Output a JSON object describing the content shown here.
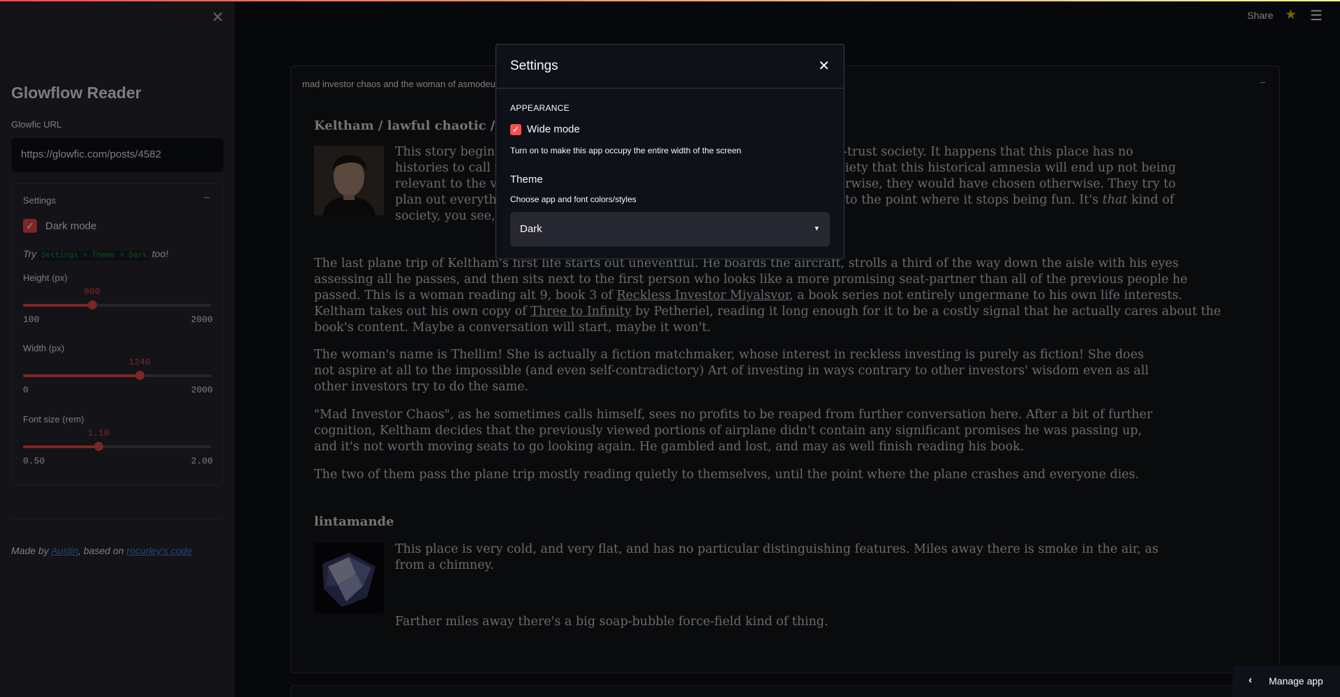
{
  "sidebar": {
    "close_glyph": "✕",
    "title": "Glowflow Reader",
    "url_label": "Glowfic URL",
    "url_value": "https://glowfic.com/posts/4582",
    "settings_title": "Settings",
    "collapse_glyph": "−",
    "dark_mode_label": "Dark mode",
    "dark_mode_checked": true,
    "try_prefix": "Try",
    "try_code": "Settings > Theme > Dark",
    "try_suffix": "too!",
    "height": {
      "label": "Height (px)",
      "value": "800",
      "min": "100",
      "max": "2000",
      "fraction": 0.3684
    },
    "width": {
      "label": "Width (px)",
      "value": "1240",
      "min": "0",
      "max": "2000",
      "fraction": 0.62
    },
    "font_size": {
      "label": "Font size (rem)",
      "value": "1.10",
      "min": "0.50",
      "max": "2.00",
      "fraction": 0.4
    },
    "credits_prefix": "Made by",
    "credits_author": "Austin",
    "credits_mid": ", based on",
    "credits_link": "rocurley's code"
  },
  "header": {
    "share_label": "Share",
    "star_icon": "★",
    "menu_icon": "☰"
  },
  "card": {
    "title": "mad investor chaos and the woman of asmodeus",
    "minimize_glyph": "–"
  },
  "posts": [
    {
      "author": "Keltham / lawful chaotic / Iarwain",
      "paragraphs": [
        "This story begins in a world called Dath Ilan, a world with a civilization that is a high-trust society.  It happens that this place has no histories to call up; it is a place where nothing bad happens and everything that this historical amnesia will end up not being relevant to the various arcs of this story, so that if the characters knew otherwise, they would have chosen otherwise.  They try to plan out everything through their extensive coordination, and they generally succeed to the point where it stops being fun.  It's that kind of society, you see, they are."
      ]
    },
    {
      "paragraphs": [
        "The last plane trip of Keltham's first life starts out uneventful.  He boards the aircraft, strolls a third of the way down the aisle with his eyes assessing all he passes, and then sits next to the first person who looks like a more promising seat-partner than all of the previous people he passed.  This is a woman reading alt 9, book 3 of Reckless Investor Miyalsvor, a book series not entirely ungermane to his own life interests.  Keltham takes out his own copy of Three to Infinity by Petheriel, reading it long enough for it to be a costly signal that he actually cares about the book's content.  Maybe a conversation will start, maybe it won't.",
        "The woman's name is Thellim!  She is actually a fiction matchmaker, whose interest in reckless investing is purely as fiction!  She does not aspire at all to the impossible (and even self-contradictory) Art of investing in ways contrary to other investors' wisdom even as all other investors try to do the same.",
        "\"Mad Investor Chaos\", as he sometimes calls himself, sees no profits to be reaped from further conversation here.  After a bit of further cognition, Keltham decides that the previously viewed portions of airplane didn't contain any significant promises he was passing up, and it's not worth moving seats to go looking again.  He gambled and lost, and may as well finish reading his book.",
        "The two of them pass the plane trip mostly reading quietly to themselves, until the point where the plane crashes and everyone dies."
      ]
    },
    {
      "author": "lintamande",
      "paragraphs": [
        "This place is very cold, and very flat, and has no particular distinguishing features. Miles away there is smoke in the air, as from a chimney.",
        "Farther miles away there's a big soap-bubble force-field kind of thing."
      ]
    }
  ],
  "visible_lines": {
    "p1_l1": "This story begins",
    "p1_l1b": "-trust society.  It happens that this place has no",
    "p1_l2": "histories to call up",
    "p1_l2b": "iety that this historical amnesia will end up not being",
    "p1_l3": "relevant to the va",
    "p1_l3b": "rwise, they would have chosen otherwise.  They try to",
    "p1_l4": "plan out everythin",
    "p1_l4b": "to the point where it stops being fun.  It's",
    "p1_l4c": "that",
    "p1_l4d": "kind of",
    "p1_l5": "society, you see, t",
    "p2_l1a": "The last plane trip of Keltham's first life starts out uneventful.  He boards the aircraft, strolls a third of the way down the aisle with his eyes",
    "p2_l2": "assessing all he passes, and then sits next to the first person who looks like a more promising seat-partner than all of the previous people he",
    "p2_l3a": "passed.  This is a woman reading alt 9, book 3 of",
    "p2_l3link": "Reckless Investor Miyalsvor",
    "p2_l3b": ", a book series not entirely ungermane to his own life interests.",
    "p2_l4a": " Keltham takes out his own copy of",
    "p2_l4link": "Three to Infinity",
    "p2_l4b": "by Petheriel, reading it long enough for it to be a costly signal that he actually cares about the",
    "p2_l5": "book's content.  Maybe a conversation will start, maybe it won't."
  },
  "modal": {
    "title": "Settings",
    "close_glyph": "✕",
    "section": "APPEARANCE",
    "wide_mode_label": "Wide mode",
    "wide_mode_checked": true,
    "wide_mode_help": "Turn on to make this app occupy the entire width of the screen",
    "theme_label": "Theme",
    "theme_help": "Choose app and font colors/styles",
    "theme_value": "Dark",
    "select_arrow": "▾"
  },
  "manage_app": {
    "chevron": "‹",
    "label": "Manage app"
  },
  "colors": {
    "accent": "#ff4b4b",
    "background": "#0e1117",
    "sidebar": "#262730",
    "star": "#f5c518",
    "code": "#09ab3b",
    "link": "#4a8de8"
  }
}
